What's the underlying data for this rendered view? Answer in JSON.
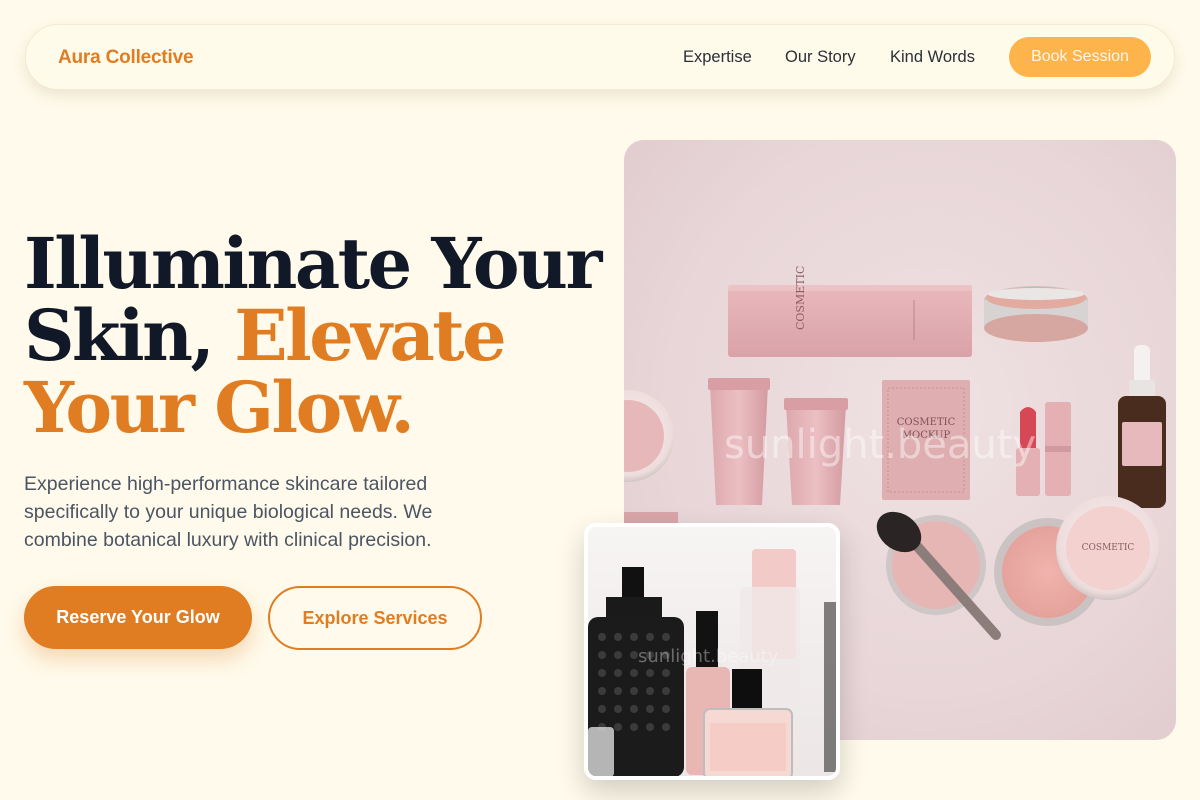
{
  "nav": {
    "brand": "Aura Collective",
    "links": [
      "Expertise",
      "Our Story",
      "Kind Words"
    ],
    "cta_label": "Book Session"
  },
  "hero": {
    "title_line1": "Illuminate Your",
    "title_line2_plain": "Skin, ",
    "title_line2_accent": "Elevate",
    "title_line3_accent": "Your Glow.",
    "subtitle": "Experience high-performance skincare tailored specifically to your unique biological needs. We combine botanical luxury with clinical precision.",
    "primary_cta": "Reserve Your Glow",
    "secondary_cta": "Explore Services"
  },
  "images": {
    "main_photo_watermark": "sunlight.beauty",
    "small_photo_watermark": "sunlight.beauty",
    "product_label_text": "COSMETIC MOCKUP"
  },
  "colors": {
    "background": "#fffaeb",
    "accent": "#e07d22",
    "button_light": "#fdb44b",
    "heading": "#111827"
  }
}
